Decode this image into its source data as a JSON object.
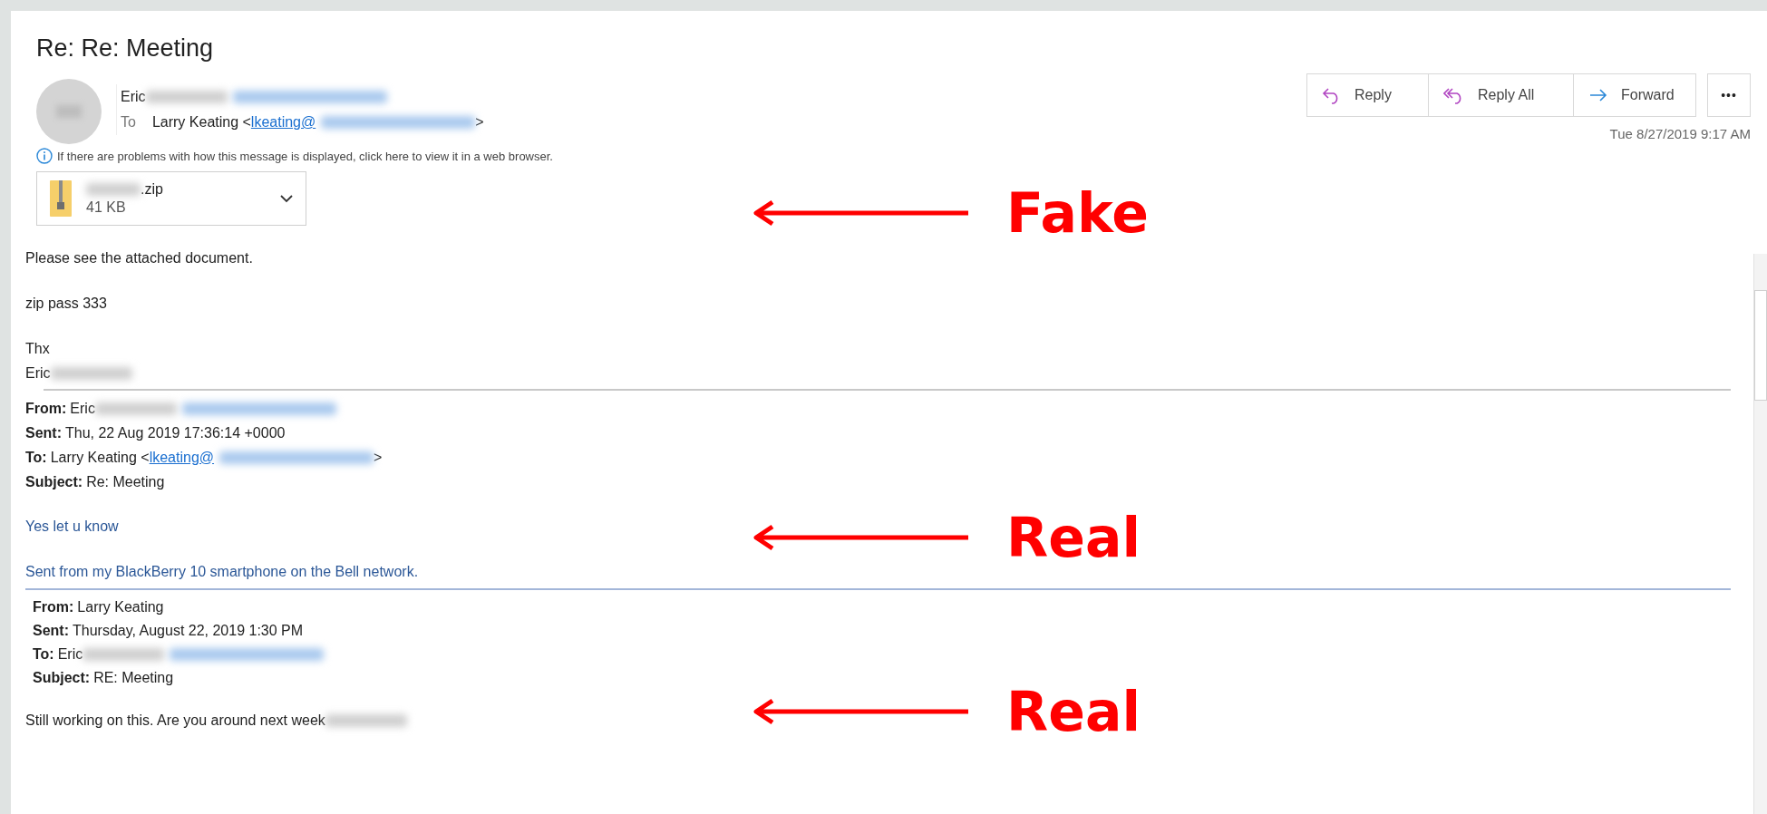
{
  "title": "Re: Re: Meeting",
  "sender": {
    "parts": [
      {
        "kind": "text",
        "text": "Eric"
      },
      {
        "kind": "redacted"
      },
      {
        "kind": "redacted_link"
      }
    ]
  },
  "recipient": {
    "label": "To",
    "parts": [
      {
        "kind": "text",
        "text": "Larry Keating <"
      },
      {
        "kind": "link",
        "text": "lkeating@"
      },
      {
        "kind": "redacted_link"
      },
      {
        "kind": "text",
        "text": ">"
      }
    ]
  },
  "actions": [
    {
      "kind": "reply",
      "label": "Reply"
    },
    {
      "kind": "reply_all",
      "label": "Reply All"
    },
    {
      "kind": "forward",
      "label": "Forward"
    }
  ],
  "more_button": "•••",
  "date": "Tue 8/27/2019 9:17 AM",
  "info_bar": "If there are problems with how this message is displayed, click here to view it in a web browser.",
  "attachment": {
    "name": ".zip",
    "size": "41 KB"
  },
  "body": [
    {
      "kind": "para",
      "parts": [
        {
          "kind": "text",
          "text": "Please see the attached document."
        }
      ]
    },
    {
      "kind": "para",
      "parts": [
        {
          "kind": "text",
          "text": "zip pass 333"
        }
      ]
    },
    {
      "kind": "line",
      "parts": [
        {
          "kind": "text",
          "text": "Thx"
        }
      ]
    },
    {
      "kind": "line",
      "parts": [
        {
          "kind": "text",
          "text": "Eric"
        },
        {
          "kind": "redacted"
        }
      ]
    },
    {
      "kind": "rule"
    },
    {
      "kind": "field",
      "label": "From:",
      "parts": [
        {
          "kind": "text",
          "text": "Eric"
        },
        {
          "kind": "redacted"
        },
        {
          "kind": "redacted_link"
        }
      ]
    },
    {
      "kind": "field",
      "label": "Sent:",
      "parts": [
        {
          "kind": "text",
          "text": "Thu, 22 Aug 2019 17:36:14 +0000"
        }
      ]
    },
    {
      "kind": "field",
      "label": "To:",
      "parts": [
        {
          "kind": "text",
          "text": "Larry Keating <"
        },
        {
          "kind": "link",
          "text": "lkeating@"
        },
        {
          "kind": "redacted_link"
        },
        {
          "kind": "text",
          "text": ">"
        }
      ]
    },
    {
      "kind": "field",
      "label": "Subject:",
      "parts": [
        {
          "kind": "text",
          "text": "Re: Meeting"
        }
      ]
    },
    {
      "kind": "blue_para",
      "parts": [
        {
          "kind": "text",
          "text": "Yes let u know"
        }
      ]
    },
    {
      "kind": "blue_para",
      "parts": [
        {
          "kind": "text",
          "text": "Sent from my BlackBerry 10 smartphone on the Bell network."
        }
      ]
    },
    {
      "kind": "blue_rule"
    },
    {
      "kind": "field",
      "label": "From:",
      "parts": [
        {
          "kind": "text",
          "text": "Larry Keating"
        }
      ]
    },
    {
      "kind": "field",
      "label": "Sent:",
      "parts": [
        {
          "kind": "text",
          "text": "Thursday, August 22, 2019 1:30 PM"
        }
      ]
    },
    {
      "kind": "field",
      "label": "To:",
      "parts": [
        {
          "kind": "text",
          "text": "Eric"
        },
        {
          "kind": "redacted"
        },
        {
          "kind": "redacted_link"
        }
      ]
    },
    {
      "kind": "field",
      "label": "Subject:",
      "parts": [
        {
          "kind": "text",
          "text": "RE: Meeting"
        }
      ]
    },
    {
      "kind": "para",
      "parts": [
        {
          "kind": "text",
          "text": "Still working on this.  Are you around next week"
        },
        {
          "kind": "redacted"
        }
      ]
    }
  ],
  "annotations": [
    {
      "label": "Fake"
    },
    {
      "label": "Real"
    },
    {
      "label": "Real"
    }
  ]
}
